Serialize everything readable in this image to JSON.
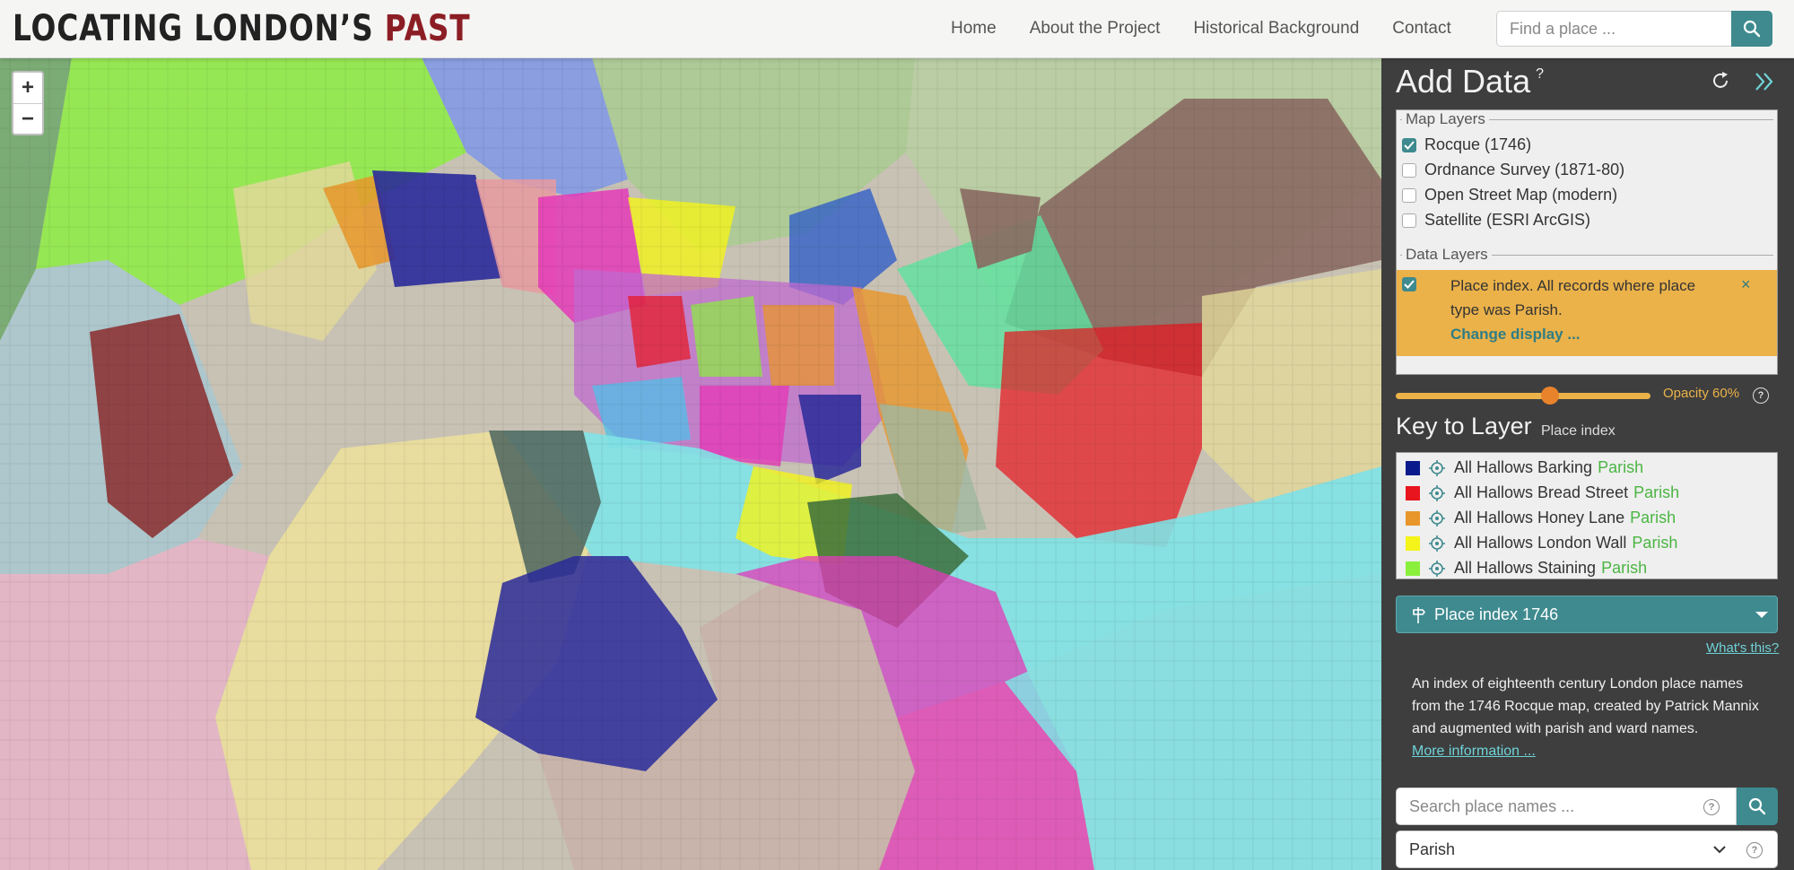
{
  "header": {
    "logo_main": "LOCATING LONDON’S ",
    "logo_accent": "PAST",
    "nav": [
      "Home",
      "About the Project",
      "Historical Background",
      "Contact"
    ],
    "search_placeholder": "Find a place ..."
  },
  "map": {
    "zoom_in": "+",
    "zoom_out": "−",
    "river_color": "#7fe3e6",
    "base_color": "#c8c2b5"
  },
  "sidebar": {
    "title": "Add Data",
    "help": "?",
    "map_layers_title": "Map Layers",
    "map_layers": [
      {
        "label": "Rocque (1746)",
        "checked": true
      },
      {
        "label": "Ordnance Survey (1871-80)",
        "checked": false
      },
      {
        "label": "Open Street Map (modern)",
        "checked": false
      },
      {
        "label": "Satellite (ESRI ArcGIS)",
        "checked": false
      }
    ],
    "data_layers_title": "Data Layers",
    "data_layer": {
      "text": "Place index. All records where place type was Parish.",
      "change": "Change display ...",
      "close": "×",
      "color": "#ebb24a"
    },
    "opacity_label": "Opacity 60%",
    "opacity_value": 0.6,
    "key_title": "Key to Layer",
    "key_subtitle": "Place index",
    "key_items": [
      {
        "name": "All Hallows Barking",
        "type": "Parish",
        "color": "#0a1a8c"
      },
      {
        "name": "All Hallows Bread Street",
        "type": "Parish",
        "color": "#e8141e"
      },
      {
        "name": "All Hallows Honey Lane",
        "type": "Parish",
        "color": "#e8962a"
      },
      {
        "name": "All Hallows London Wall",
        "type": "Parish",
        "color": "#f4f41a"
      },
      {
        "name": "All Hallows Staining",
        "type": "Parish",
        "color": "#8af03c"
      }
    ],
    "index_select": "Place index 1746",
    "whats_this": "What's this?",
    "description": "An index of eighteenth century London place names from the 1746 Rocque map, created by Patrick Mannix and augmented with parish and ward names.",
    "more_info": "More information ...",
    "place_search_placeholder": "Search place names ...",
    "type_select": "Parish"
  }
}
